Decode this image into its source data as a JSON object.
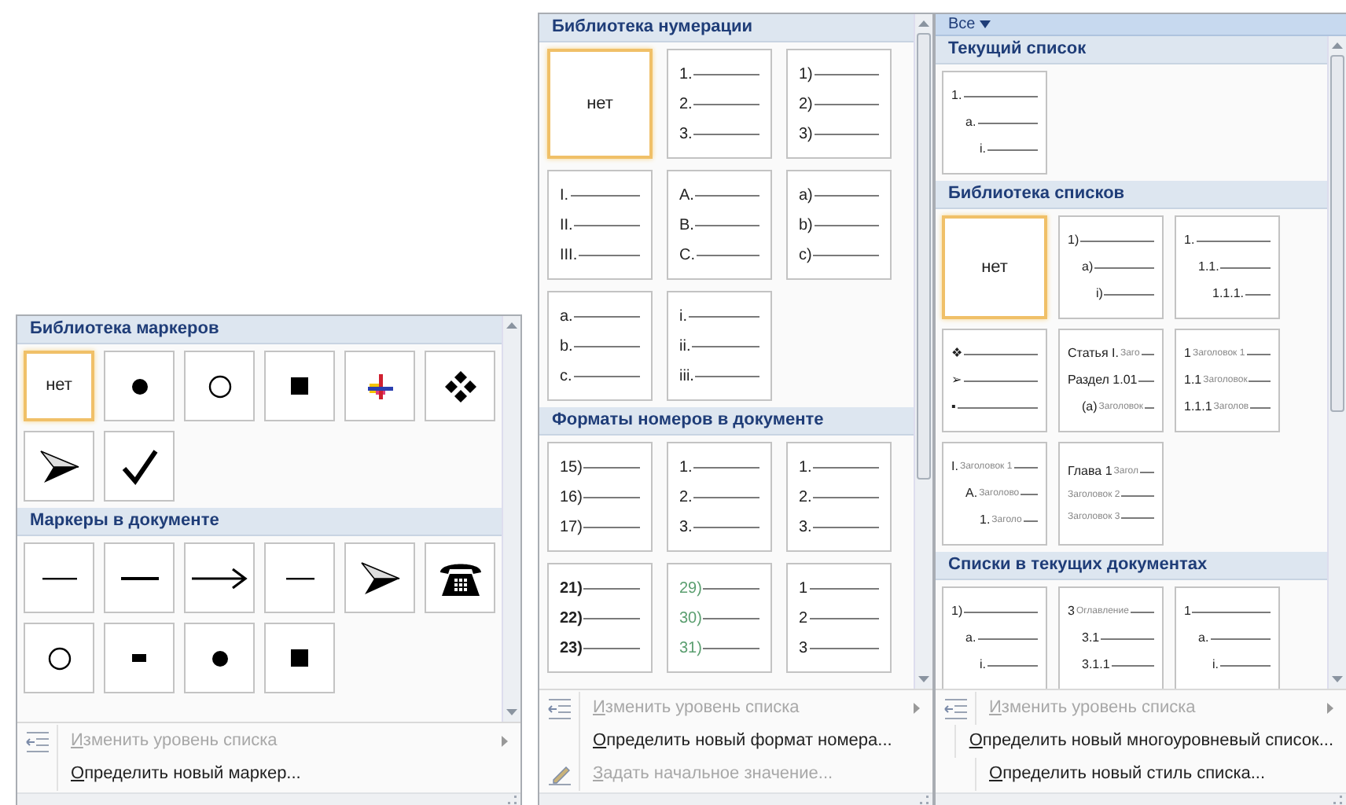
{
  "panels": [
    {
      "kind": "bullets",
      "sections": [
        {
          "title": "Библиотека маркеров",
          "tiles": [
            {
              "kind": "none",
              "label": "нет",
              "selected": true
            },
            {
              "kind": "disc",
              "selected": false
            },
            {
              "kind": "circle",
              "selected": false
            },
            {
              "kind": "square",
              "selected": false
            },
            {
              "kind": "cross",
              "selected": false
            },
            {
              "kind": "diamonds",
              "selected": false
            },
            {
              "kind": "arrowhead",
              "selected": false
            },
            {
              "kind": "check",
              "selected": false
            }
          ]
        },
        {
          "title": "Маркеры в документе",
          "tiles": [
            {
              "kind": "rule-thin",
              "selected": false
            },
            {
              "kind": "rule",
              "selected": false
            },
            {
              "kind": "arrow",
              "selected": false
            },
            {
              "kind": "rule-short",
              "selected": false
            },
            {
              "kind": "arrowhead",
              "selected": false
            },
            {
              "kind": "phone",
              "selected": false
            },
            {
              "kind": "circle",
              "selected": false
            },
            {
              "kind": "dash",
              "selected": false
            },
            {
              "kind": "disc",
              "selected": false
            },
            {
              "kind": "square",
              "selected": false
            }
          ]
        }
      ],
      "menu": [
        {
          "label": "Изменить уровень списка",
          "disabled": true,
          "submenu": true,
          "kind": "level"
        },
        {
          "label": "Определить новый маркер...",
          "disabled": false,
          "submenu": false,
          "kind": "plain"
        }
      ]
    },
    {
      "kind": "numbering",
      "sections": [
        {
          "title": "Библиотека нумерации",
          "tiles": [
            {
              "kind": "none",
              "label": "нет",
              "selected": true
            },
            {
              "kind": "list",
              "selected": false,
              "lines": [
                {
                  "label": "1."
                },
                {
                  "label": "2."
                },
                {
                  "label": "3."
                }
              ]
            },
            {
              "kind": "list",
              "selected": false,
              "lines": [
                {
                  "label": "1)"
                },
                {
                  "label": "2)"
                },
                {
                  "label": "3)"
                }
              ]
            },
            {
              "kind": "list",
              "selected": false,
              "lines": [
                {
                  "label": "I."
                },
                {
                  "label": "II."
                },
                {
                  "label": "III."
                }
              ]
            },
            {
              "kind": "list",
              "selected": false,
              "lines": [
                {
                  "label": "A."
                },
                {
                  "label": "B."
                },
                {
                  "label": "C."
                }
              ]
            },
            {
              "kind": "list",
              "selected": false,
              "lines": [
                {
                  "label": "a)"
                },
                {
                  "label": "b)"
                },
                {
                  "label": "c)"
                }
              ]
            },
            {
              "kind": "list",
              "selected": false,
              "lines": [
                {
                  "label": "a."
                },
                {
                  "label": "b."
                },
                {
                  "label": "c."
                }
              ]
            },
            {
              "kind": "list",
              "selected": false,
              "lines": [
                {
                  "label": "i."
                },
                {
                  "label": "ii."
                },
                {
                  "label": "iii."
                }
              ]
            }
          ]
        },
        {
          "title": "Форматы номеров в документе",
          "tiles": [
            {
              "kind": "list",
              "selected": false,
              "lines": [
                {
                  "label": "15)"
                },
                {
                  "label": "16)"
                },
                {
                  "label": "17)"
                }
              ]
            },
            {
              "kind": "list",
              "selected": false,
              "lines": [
                {
                  "label": "1."
                },
                {
                  "label": "2."
                },
                {
                  "label": "3."
                }
              ]
            },
            {
              "kind": "list",
              "selected": false,
              "lines": [
                {
                  "label": "1."
                },
                {
                  "label": "2."
                },
                {
                  "label": "3."
                }
              ]
            },
            {
              "kind": "list",
              "selected": false,
              "bold": true,
              "lines": [
                {
                  "label": "21)"
                },
                {
                  "label": "22)"
                },
                {
                  "label": "23)"
                }
              ]
            },
            {
              "kind": "list",
              "selected": false,
              "color": "#5a9e6f",
              "lines": [
                {
                  "label": "29)"
                },
                {
                  "label": "30)"
                },
                {
                  "label": "31)"
                }
              ]
            },
            {
              "kind": "list",
              "selected": false,
              "lines": [
                {
                  "label": "1"
                },
                {
                  "label": "2"
                },
                {
                  "label": "3"
                }
              ]
            }
          ]
        }
      ],
      "menu": [
        {
          "label": "Изменить уровень списка",
          "disabled": true,
          "submenu": true,
          "kind": "level"
        },
        {
          "label": "Определить новый формат номера...",
          "disabled": false,
          "submenu": false,
          "kind": "plain"
        },
        {
          "label": "Задать начальное значение...",
          "disabled": true,
          "submenu": false,
          "kind": "start"
        }
      ]
    },
    {
      "kind": "multilevel",
      "filter": {
        "label": "Все"
      },
      "sections": [
        {
          "title": "Текущий список",
          "tiles": [
            {
              "kind": "list",
              "selected": false,
              "lines": [
                {
                  "label": "1.",
                  "children": [
                    {
                      "label": "a.",
                      "children": [
                        {
                          "label": "i."
                        }
                      ]
                    }
                  ]
                }
              ]
            }
          ]
        },
        {
          "title": "Библиотека списков",
          "tiles": [
            {
              "kind": "none",
              "label": "нет",
              "selected": true
            },
            {
              "kind": "list",
              "selected": false,
              "lines": [
                {
                  "label": "1)",
                  "children": [
                    {
                      "label": "a)",
                      "children": [
                        {
                          "label": "i)"
                        }
                      ]
                    }
                  ]
                }
              ]
            },
            {
              "kind": "list",
              "selected": false,
              "lines": [
                {
                  "label": "1.",
                  "children": [
                    {
                      "label": "1.1.",
                      "children": [
                        {
                          "label": "1.1.1."
                        }
                      ]
                    }
                  ]
                }
              ]
            },
            {
              "kind": "list",
              "selected": false,
              "lines": [
                {
                  "label": "❖"
                },
                {
                  "label": "➢"
                },
                {
                  "label": "▪"
                }
              ]
            },
            {
              "kind": "list",
              "selected": false,
              "lines": [
                {
                  "label": "Статья I.",
                  "text": "Заго"
                },
                {
                  "label": "Раздел 1.01",
                  "children": [
                    {
                      "label": "(a)",
                      "text": "Заголовок"
                    }
                  ]
                }
              ]
            },
            {
              "kind": "list",
              "selected": false,
              "lines": [
                {
                  "label": "1",
                  "text": "Заголовок 1"
                },
                {
                  "label": "1.1",
                  "text": "Заголовок"
                },
                {
                  "label": "1.1.1",
                  "text": "Заголов"
                }
              ]
            },
            {
              "kind": "list",
              "selected": false,
              "lines": [
                {
                  "label": "I.",
                  "text": "Заголовок 1",
                  "children": [
                    {
                      "label": "A.",
                      "text": "Заголово",
                      "children": [
                        {
                          "label": "1.",
                          "text": "Заголо"
                        }
                      ]
                    }
                  ]
                }
              ]
            },
            {
              "kind": "list",
              "selected": false,
              "lines": [
                {
                  "label": "Глава 1",
                  "text": "Загол"
                },
                {
                  "text": "Заголовок 2"
                },
                {
                  "text": "Заголовок 3"
                }
              ]
            }
          ]
        },
        {
          "title": "Списки в текущих документах",
          "tiles": [
            {
              "kind": "list",
              "selected": false,
              "lines": [
                {
                  "label": "1)",
                  "children": [
                    {
                      "label": "a.",
                      "children": [
                        {
                          "label": "i."
                        }
                      ]
                    }
                  ]
                }
              ]
            },
            {
              "kind": "list",
              "selected": false,
              "lines": [
                {
                  "label": "3",
                  "text": "Оглавление",
                  "children": [
                    {
                      "label": "3.1"
                    },
                    {
                      "label": "3.1.1"
                    }
                  ]
                }
              ]
            },
            {
              "kind": "list",
              "selected": false,
              "lines": [
                {
                  "label": "1",
                  "children": [
                    {
                      "label": "a.",
                      "children": [
                        {
                          "label": "i."
                        }
                      ]
                    }
                  ]
                }
              ]
            }
          ]
        }
      ],
      "menu": [
        {
          "label": "Изменить уровень списка",
          "disabled": true,
          "submenu": true,
          "kind": "level"
        },
        {
          "label": "Определить новый многоуровневый список...",
          "disabled": false,
          "submenu": false,
          "kind": "plain"
        },
        {
          "label": "Определить новый стиль списка...",
          "disabled": false,
          "submenu": false,
          "kind": "plain"
        }
      ]
    }
  ]
}
